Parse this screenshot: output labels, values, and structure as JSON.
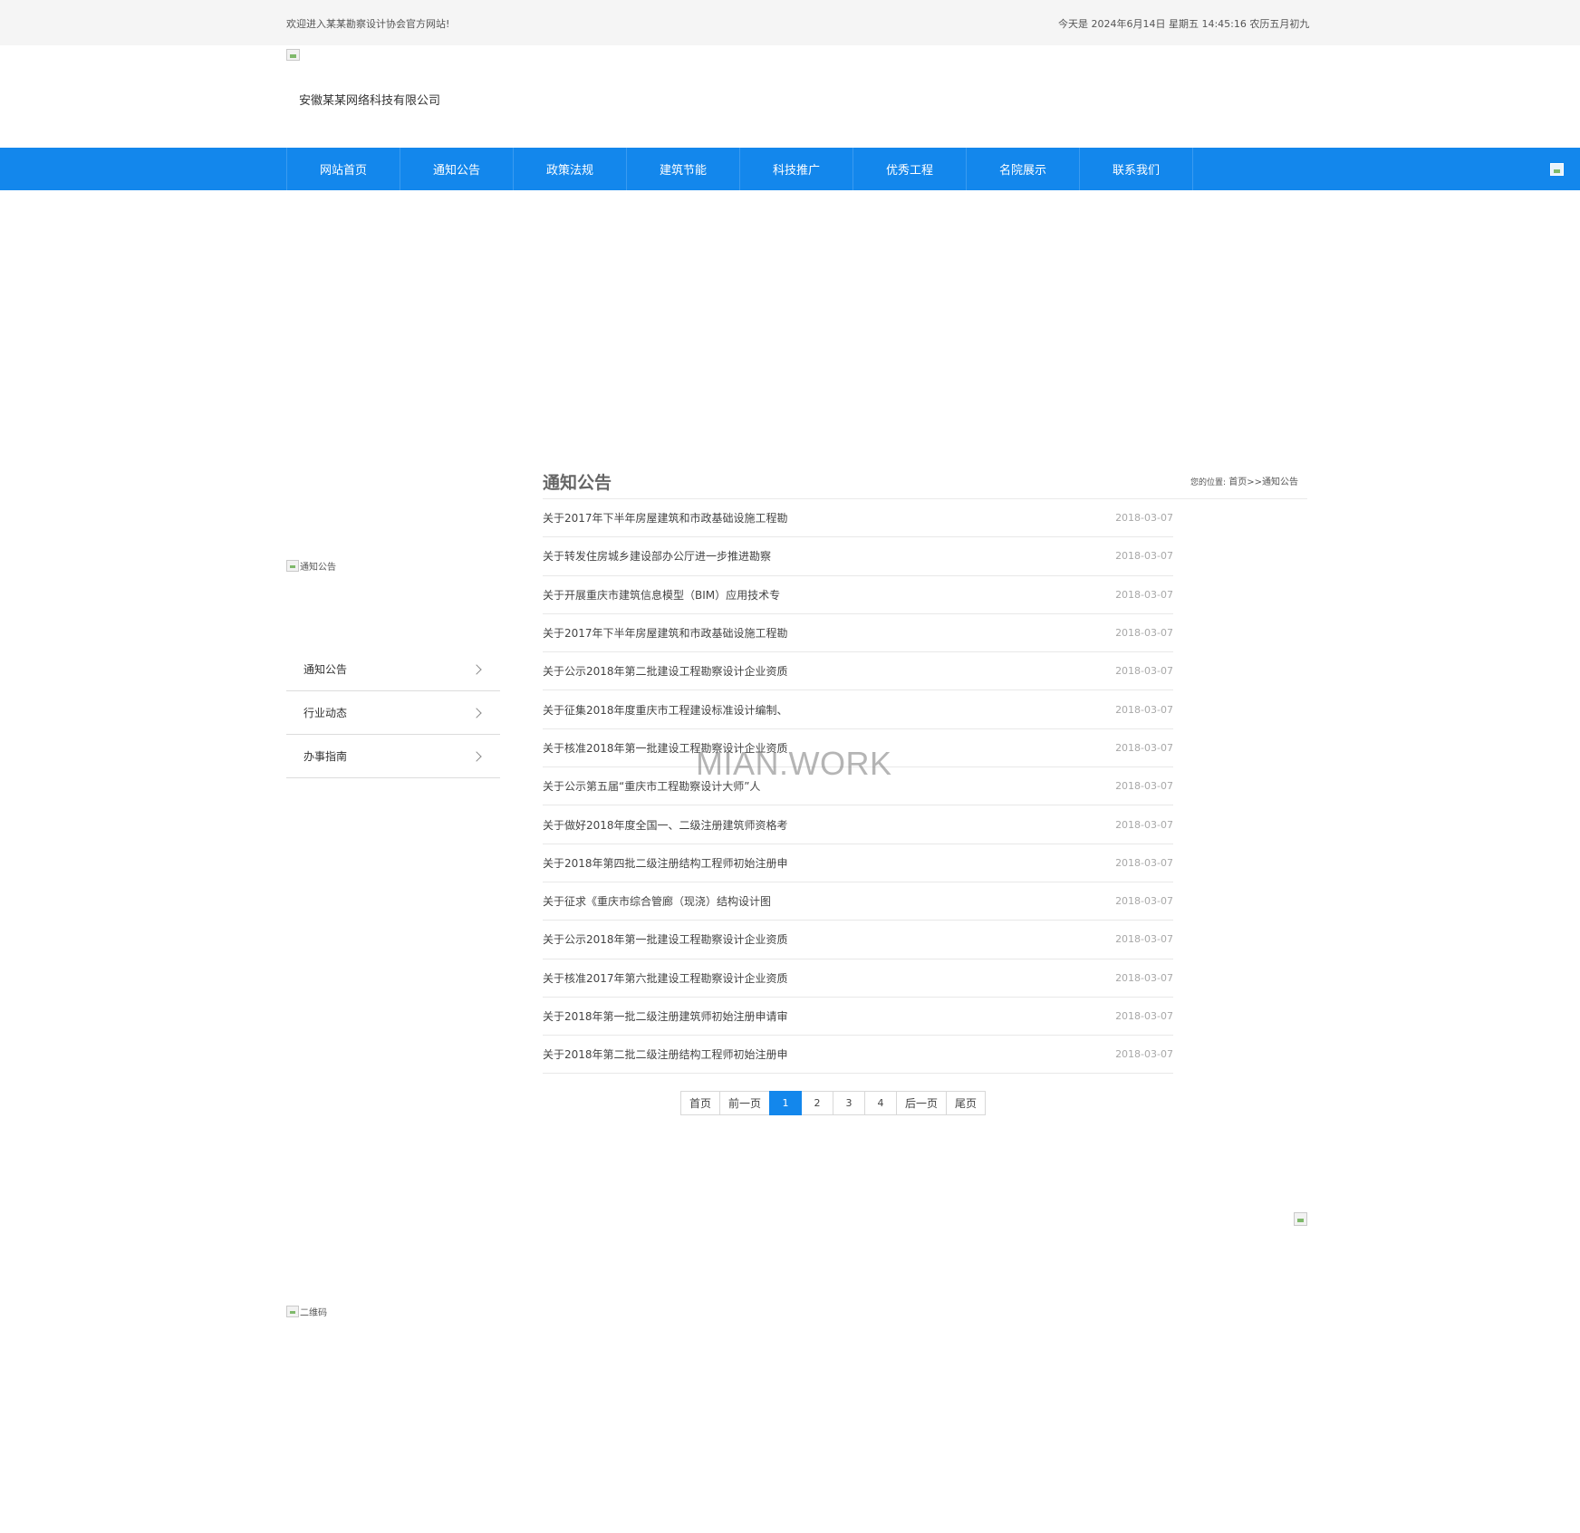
{
  "topbar": {
    "welcome": "欢迎进入某某勘察设计协会官方网站!",
    "datetime": "今天是 2024年6月14日 星期五 14:45:16 农历五月初九"
  },
  "header": {
    "company": "安徽某某网络科技有限公司"
  },
  "nav": {
    "items": [
      "网站首页",
      "通知公告",
      "政策法规",
      "建筑节能",
      "科技推广",
      "优秀工程",
      "名院展示",
      "联系我们"
    ]
  },
  "sidebar": {
    "banner_alt": "通知公告",
    "items": [
      "通知公告",
      "行业动态",
      "办事指南"
    ]
  },
  "main": {
    "title": "通知公告",
    "breadcrumb_label": "您的位置:",
    "breadcrumb_path": "首页>>通知公告",
    "news": [
      {
        "title": "关于2017年下半年房屋建筑和市政基础设施工程勘",
        "date": "2018-03-07"
      },
      {
        "title": "关于转发住房城乡建设部办公厅进一步推进勘察",
        "date": "2018-03-07"
      },
      {
        "title": "关于开展重庆市建筑信息模型（BIM）应用技术专",
        "date": "2018-03-07"
      },
      {
        "title": "关于2017年下半年房屋建筑和市政基础设施工程勘",
        "date": "2018-03-07"
      },
      {
        "title": "关于公示2018年第二批建设工程勘察设计企业资质",
        "date": "2018-03-07"
      },
      {
        "title": "关于征集2018年度重庆市工程建设标准设计编制、",
        "date": "2018-03-07"
      },
      {
        "title": "关于核准2018年第一批建设工程勘察设计企业资质",
        "date": "2018-03-07"
      },
      {
        "title": "关于公示第五届“重庆市工程勘察设计大师”人",
        "date": "2018-03-07"
      },
      {
        "title": "关于做好2018年度全国一、二级注册建筑师资格考",
        "date": "2018-03-07"
      },
      {
        "title": "关于2018年第四批二级注册结构工程师初始注册申",
        "date": "2018-03-07"
      },
      {
        "title": "关于征求《重庆市综合管廊（现浇）结构设计图",
        "date": "2018-03-07"
      },
      {
        "title": "关于公示2018年第一批建设工程勘察设计企业资质",
        "date": "2018-03-07"
      },
      {
        "title": "关于核准2017年第六批建设工程勘察设计企业资质",
        "date": "2018-03-07"
      },
      {
        "title": "关于2018年第一批二级注册建筑师初始注册申请审",
        "date": "2018-03-07"
      },
      {
        "title": "关于2018年第二批二级注册结构工程师初始注册申",
        "date": "2018-03-07"
      }
    ]
  },
  "pager": {
    "first": "首页",
    "prev": "前一页",
    "pages": [
      "1",
      "2",
      "3",
      "4"
    ],
    "current_page": "1",
    "next": "后一页",
    "last": "尾页"
  },
  "watermark": "MIAN.WORK",
  "footer": {
    "qrcode_alt": "二维码"
  },
  "colors": {
    "accent": "#1387ec",
    "topbar_bg": "#f5f5f5"
  }
}
